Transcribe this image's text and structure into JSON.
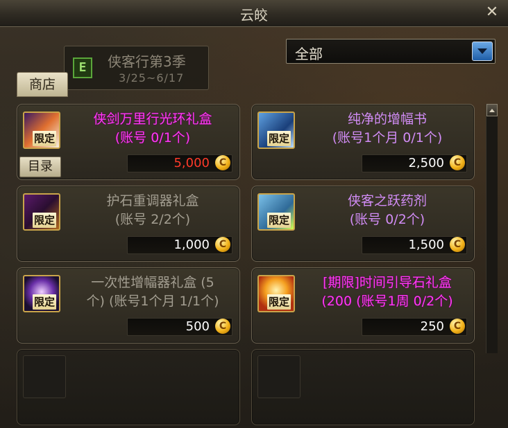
{
  "window": {
    "title": "云皎",
    "close": "✕"
  },
  "season": {
    "icon_letter": "E",
    "title": "侠客行第3季",
    "date": "3/25~6/17"
  },
  "filter": {
    "selected": "全部"
  },
  "tabs": {
    "shop": "商店"
  },
  "catalog_button": "目录",
  "items": [
    {
      "name_line1": "侠剑万里行光环礼盒",
      "name_line2": "(账号 0/1个)",
      "limit": "限定",
      "price": "5,000",
      "icon": "sword-halo-box-icon",
      "name_color": "pink",
      "price_color": "red"
    },
    {
      "name_line1": "纯净的增幅书",
      "name_line2": "(账号1个月 0/1个)",
      "limit": "限定",
      "price": "2,500",
      "icon": "amplify-book-icon",
      "name_color": "purple",
      "price_color": "white"
    },
    {
      "name_line1": "护石重调器礼盒",
      "name_line2": "(账号 2/2个)",
      "limit": "限定",
      "price": "1,000",
      "icon": "talisman-tuner-box-icon",
      "name_color": "gray",
      "price_color": "white"
    },
    {
      "name_line1": "侠客之跃药剂",
      "name_line2": "(账号 0/2个)",
      "limit": "限定",
      "price": "1,500",
      "icon": "leap-potion-icon",
      "name_color": "purple",
      "price_color": "white"
    },
    {
      "name_line1": "一次性增幅器礼盒 (5",
      "name_line2": "个) (账号1个月 1/1个)",
      "limit": "限定",
      "price": "500",
      "icon": "disposable-amplifier-box-icon",
      "name_color": "gray",
      "price_color": "white"
    },
    {
      "name_line1": "[期限]时间引导石礼盒",
      "name_line2": "(200 (账号1周 0/2个)",
      "limit": "限定",
      "price": "250",
      "icon": "time-guide-stone-box-icon",
      "name_color": "pink",
      "price_color": "white"
    }
  ],
  "coin_symbol": "C",
  "colors": {
    "pink_name": "#ff38f6",
    "purple_name": "#d18cf5",
    "gray_name": "#a39e91",
    "red_price": "#ff3a2a",
    "accent_blue": "#1f5ea8"
  }
}
